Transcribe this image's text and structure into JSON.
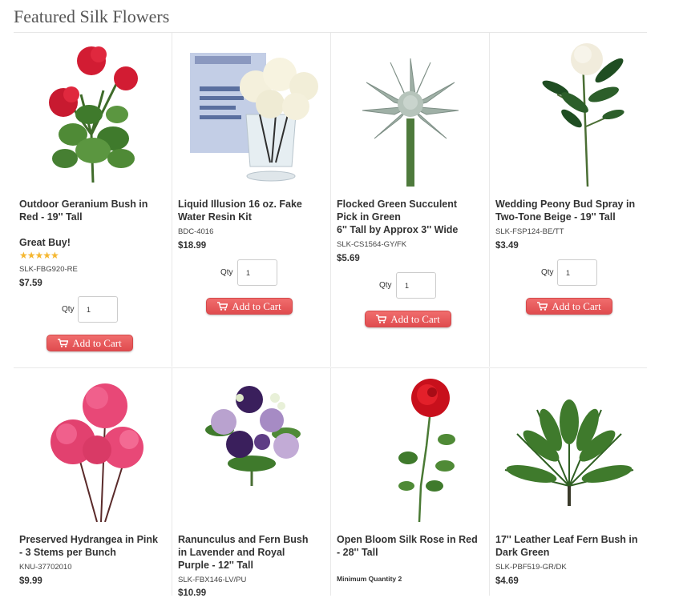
{
  "section": {
    "title": "Featured Silk Flowers"
  },
  "products": [
    {
      "name_lines": [
        "Outdoor Geranium Bush in",
        "Red - 19'' Tall"
      ],
      "badge": "Great Buy!",
      "rating_stars": "★★★★★",
      "sku": "SLK-FBG920-RE",
      "price": "$7.59",
      "qty_label": "Qty",
      "qty_value": "1",
      "cart_label": "Add to Cart",
      "image_icon": "geranium-bush"
    },
    {
      "name_lines": [
        "Liquid Illusion 16 oz. Fake",
        "Water Resin Kit"
      ],
      "sku": "BDC-4016",
      "price": "$18.99",
      "qty_label": "Qty",
      "qty_value": "1",
      "cart_label": "Add to Cart",
      "image_icon": "resin-kit-roses"
    },
    {
      "name_lines": [
        "Flocked Green Succulent",
        "Pick in Green",
        "6'' Tall by Approx 3'' Wide"
      ],
      "sku": "SLK-CS1564-GY/FK",
      "price": "$5.69",
      "qty_label": "Qty",
      "qty_value": "1",
      "cart_label": "Add to Cart",
      "image_icon": "succulent-pick"
    },
    {
      "name_lines": [
        "Wedding Peony Bud Spray in",
        "Two-Tone Beige  - 19'' Tall"
      ],
      "sku": "SLK-FSP124-BE/TT",
      "price": "$3.49",
      "qty_label": "Qty",
      "qty_value": "1",
      "cart_label": "Add to Cart",
      "image_icon": "peony-spray"
    },
    {
      "name_lines": [
        "Preserved Hydrangea in Pink",
        "- 3 Stems per Bunch"
      ],
      "sku": "KNU-37702010",
      "price": "$9.99",
      "image_icon": "hydrangea"
    },
    {
      "name_lines": [
        "Ranunculus and Fern Bush",
        "in Lavender and Royal",
        "Purple - 12'' Tall"
      ],
      "sku": "SLK-FBX146-LV/PU",
      "price": "$10.99",
      "image_icon": "ranunculus-bush"
    },
    {
      "name_lines": [
        "Open Bloom Silk Rose in Red",
        " - 28'' Tall"
      ],
      "min_qty": "Minimum Quantity 2",
      "image_icon": "red-rose"
    },
    {
      "name_lines": [
        "17'' Leather Leaf Fern Bush in",
        "Dark Green"
      ],
      "sku": "SLK-PBF519-GR/DK",
      "price": "$4.69",
      "image_icon": "fern-bush"
    }
  ],
  "colors": {
    "button": "#e8565a",
    "rule": "#e8e8e8",
    "stars": "#f5b731"
  }
}
